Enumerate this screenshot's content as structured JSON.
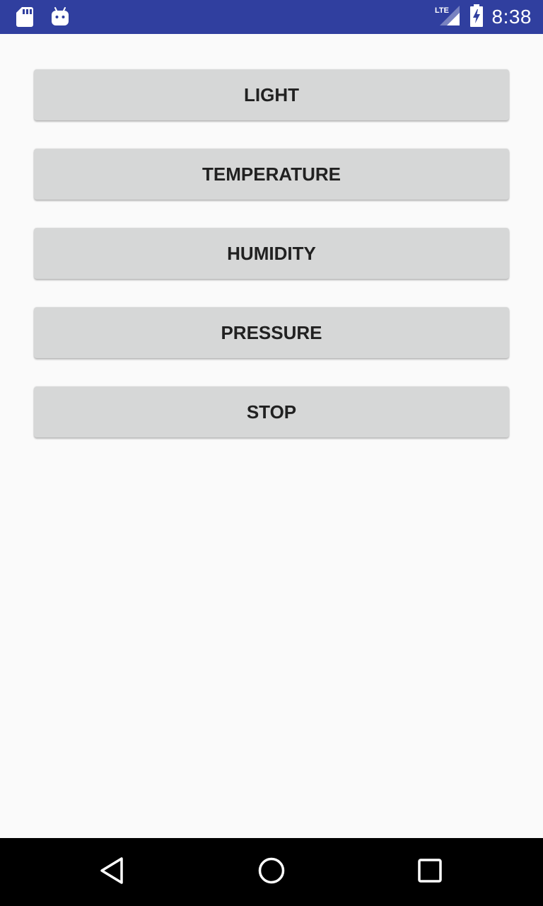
{
  "status_bar": {
    "time": "8:38",
    "network": "LTE",
    "icons": [
      "sd-card-icon",
      "android-icon",
      "lte-signal-icon",
      "battery-charging-icon"
    ],
    "background_color": "#303f9f"
  },
  "buttons": [
    {
      "label": "LIGHT"
    },
    {
      "label": "TEMPERATURE"
    },
    {
      "label": "HUMIDITY"
    },
    {
      "label": "PRESSURE"
    },
    {
      "label": "STOP"
    }
  ],
  "navigation": {
    "icons": [
      "back-icon",
      "home-icon",
      "recents-icon"
    ]
  }
}
